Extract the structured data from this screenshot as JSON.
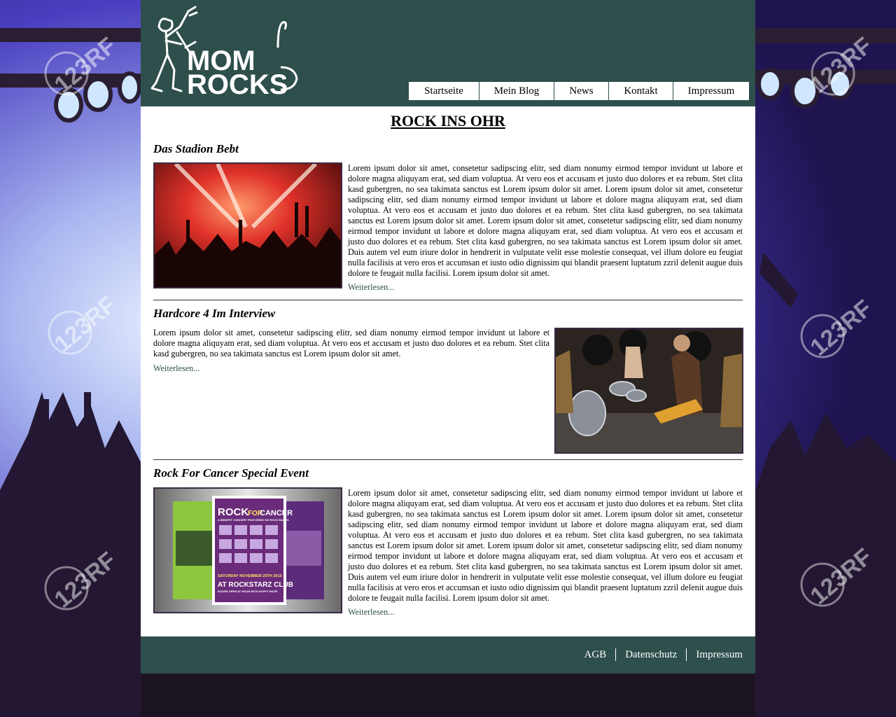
{
  "site": {
    "logo_alt": "Mom Rocks",
    "logo_line1": "MOM",
    "logo_line2": "ROCKS"
  },
  "nav": [
    {
      "label": "Startseite"
    },
    {
      "label": "Mein Blog"
    },
    {
      "label": "News"
    },
    {
      "label": "Kontakt"
    },
    {
      "label": "Impressum"
    }
  ],
  "main": {
    "title": "ROCK INS OHR",
    "articles": [
      {
        "title": "Das Stadion Bebt",
        "text": "Lorem ipsum dolor sit amet, consetetur sadipscing elitr, sed diam nonumy eirmod tempor invidunt ut labore et dolore magna aliquyam erat, sed diam voluptua. At vero eos et accusam et justo duo dolores et ea rebum. Stet clita kasd gubergren, no sea takimata sanctus est Lorem ipsum dolor sit amet. Lorem ipsum dolor sit amet, consetetur sadipscing elitr, sed diam nonumy eirmod tempor invidunt ut labore et dolore magna aliquyam erat, sed diam voluptua. At vero eos et accusam et justo duo dolores et ea rebum. Stet clita kasd gubergren, no sea takimata sanctus est Lorem ipsum dolor sit amet. Lorem ipsum dolor sit amet, consetetur sadipscing elitr, sed diam nonumy eirmod tempor invidunt ut labore et dolore magna aliquyam erat, sed diam voluptua. At vero eos et accusam et justo duo dolores et ea rebum. Stet clita kasd gubergren, no sea takimata sanctus est Lorem ipsum dolor sit amet. Duis autem vel eum iriure dolor in hendrerit in vulputate velit esse molestie consequat, vel illum dolore eu feugiat nulla facilisis at vero eros et accumsan et iusto odio dignissim qui blandit praesent luptatum zzril delenit augue duis dolore te feugait nulla facilisi. Lorem ipsum dolor sit amet.",
        "read_more": "Weiterlesen..."
      },
      {
        "title": "Hardcore 4 Im Interview",
        "text": "Lorem ipsum dolor sit amet, consetetur sadipscing elitr, sed diam nonumy eirmod tempor invidunt ut labore et dolore magna aliquyam erat, sed diam voluptua. At vero eos et accusam et justo duo dolores et ea rebum. Stet clita kasd gubergren, no sea takimata sanctus est Lorem ipsum dolor sit amet.",
        "read_more": "Weiterlesen..."
      },
      {
        "title": "Rock For Cancer Special Event",
        "text": "Lorem ipsum dolor sit amet, consetetur sadipscing elitr, sed diam nonumy eirmod tempor invidunt ut labore et dolore magna aliquyam erat, sed diam voluptua. At vero eos et accusam et justo duo dolores et ea rebum. Stet clita kasd gubergren, no sea takimata sanctus est Lorem ipsum dolor sit amet. Lorem ipsum dolor sit amet, consetetur sadipscing elitr, sed diam nonumy eirmod tempor invidunt ut labore et dolore magna aliquyam erat, sed diam voluptua. At vero eos et accusam et justo duo dolores et ea rebum. Stet clita kasd gubergren, no sea takimata sanctus est Lorem ipsum dolor sit amet. Lorem ipsum dolor sit amet, consetetur sadipscing elitr, sed diam nonumy eirmod tempor invidunt ut labore et dolore magna aliquyam erat, sed diam voluptua. At vero eos et accusam et justo duo dolores et ea rebum. Stet clita kasd gubergren, no sea takimata sanctus est Lorem ipsum dolor sit amet. Duis autem vel eum iriure dolor in hendrerit in vulputate velit esse molestie consequat, vel illum dolore eu feugiat nulla facilisis at vero eros et accumsan et iusto odio dignissim qui blandit praesent luptatum zzril delenit augue duis dolore te feugait nulla facilisi. Lorem ipsum dolor sit amet.",
        "read_more": "Weiterlesen...",
        "poster": {
          "title_a": "ROCK",
          "title_for": "FOR",
          "title_b": "CANCER",
          "subtitle": "A BENEFIT CONCERT FEATURING SIX ROCK BANDS",
          "date": "SATURDAY NOVEMBER 25TH 2013",
          "venue": "AT ROCKSTARZ CLUB",
          "doors": "DOORS OPEN AT NOON WITH HAPPY HOUR"
        }
      }
    ]
  },
  "footer": {
    "links": [
      {
        "label": "AGB"
      },
      {
        "label": "Datenschutz"
      },
      {
        "label": "Impressum"
      }
    ]
  },
  "watermark": "123RF",
  "colors": {
    "header_bg": "#2e4f4c",
    "content_bg": "#ffffff",
    "link": "#2e4f4c",
    "border": "#3a2a44"
  }
}
